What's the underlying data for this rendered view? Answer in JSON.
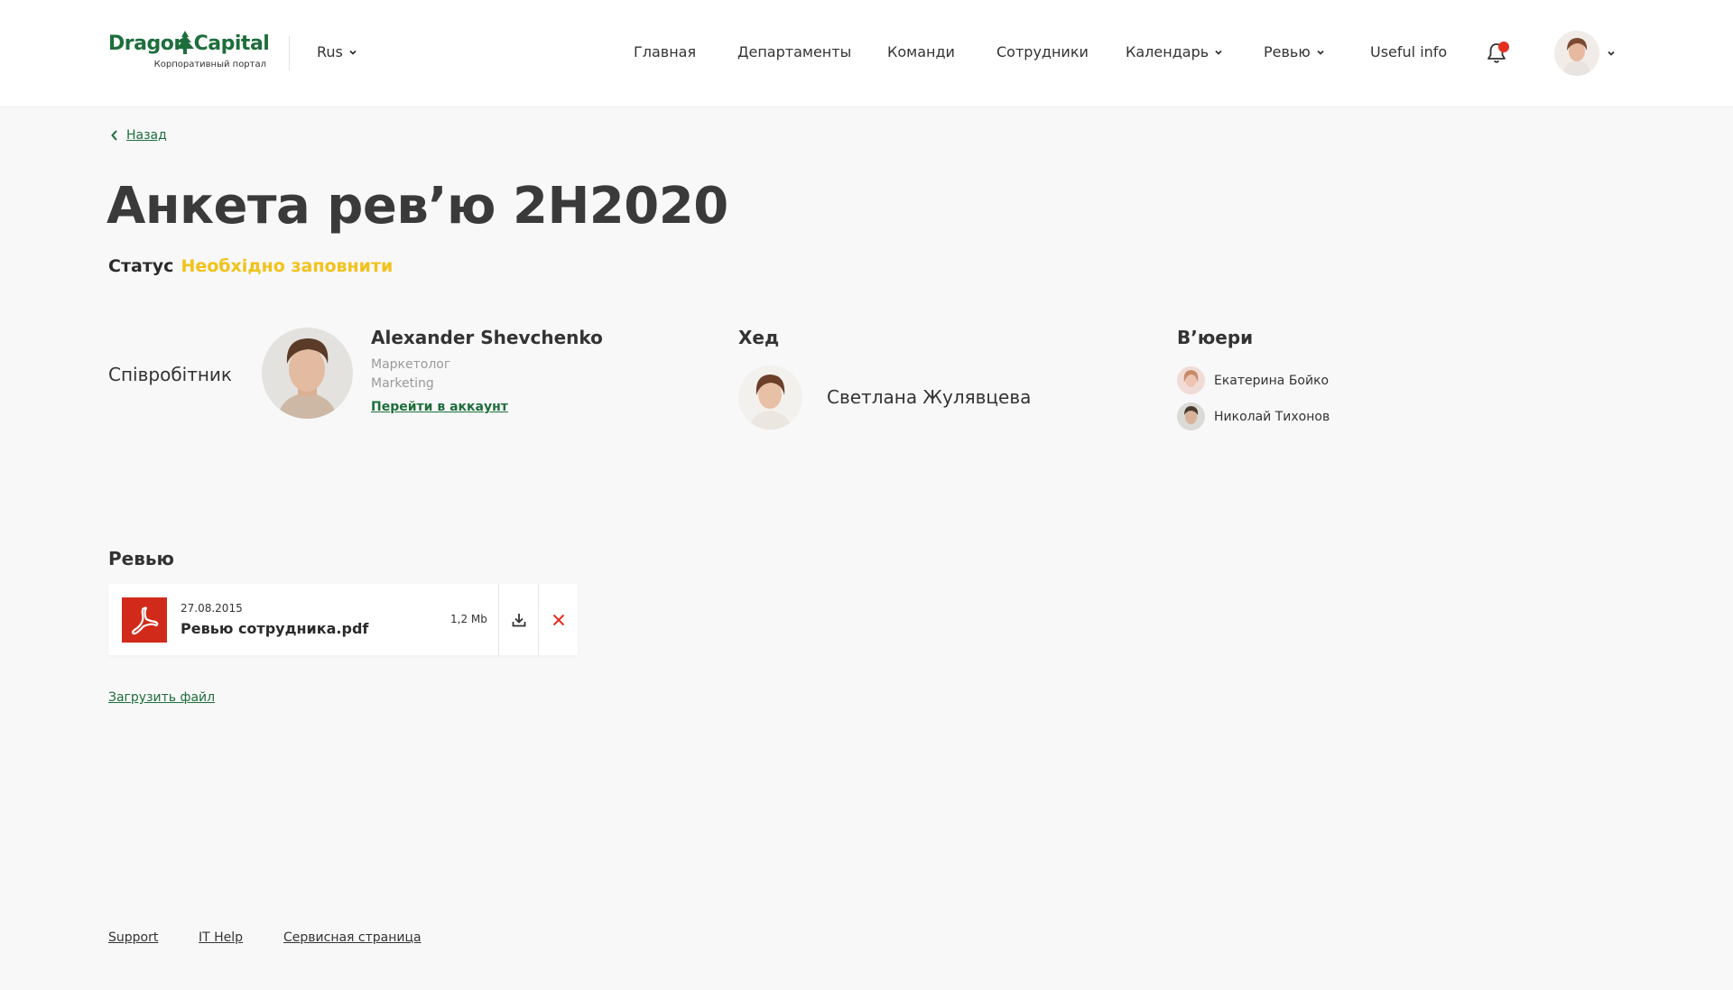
{
  "header": {
    "logo_text": "Dragon Capital",
    "logo_subtitle": "Корпоративный портал",
    "language": "Rus",
    "nav": [
      {
        "label": "Главная"
      },
      {
        "label": "Департаменты"
      },
      {
        "label": "Команди"
      },
      {
        "label": "Сотрудники"
      },
      {
        "label": "Календарь"
      },
      {
        "label": "Ревью"
      },
      {
        "label": "Useful info"
      }
    ]
  },
  "back_label": "Назад",
  "title": "Анкета ревʼю 2H2020",
  "status": {
    "label": "Статус",
    "value": "Необхідно заповнити",
    "color": "#f2c21b"
  },
  "employee": {
    "section_label": "Співробітник",
    "name": "Alexander Shevchenko",
    "role": "Маркетолог",
    "department": "Marketing",
    "link": "Перейти в аккаунт"
  },
  "head": {
    "title": "Хед",
    "name": "Светлана Жулявцева"
  },
  "viewers": {
    "title": "В’юери",
    "items": [
      {
        "name": "Екатерина Бойко"
      },
      {
        "name": "Николай Тихонов"
      }
    ]
  },
  "review": {
    "title": "Ревью",
    "file": {
      "date": "27.08.2015",
      "name": "Ревью сотрудника.pdf",
      "size": "1,2 Mb"
    },
    "upload_label": "Загрузить файл"
  },
  "footer": {
    "links": [
      "Support",
      "IT Help",
      "Сервисная страница"
    ]
  },
  "colors": {
    "brand": "#1e6e3c",
    "danger": "#d22a1a",
    "notification": "#e42f1e"
  }
}
